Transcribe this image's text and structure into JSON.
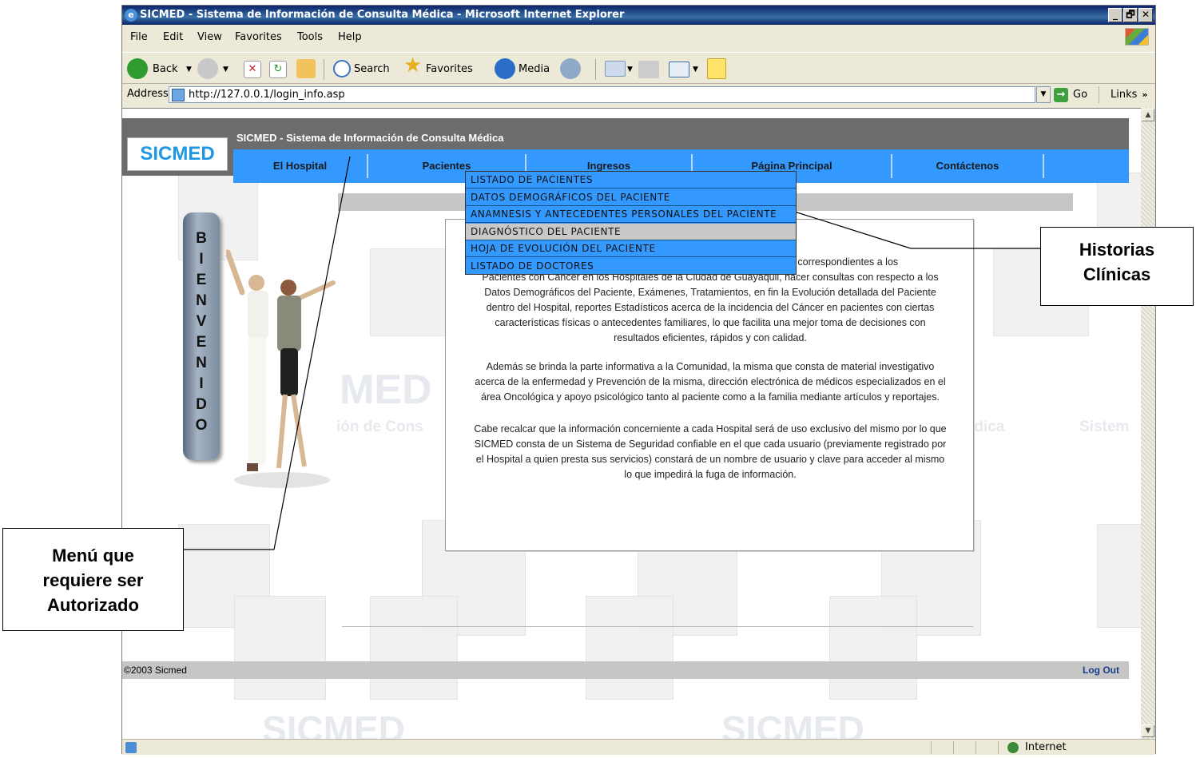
{
  "window": {
    "title": "SICMED - Sistema de Información de Consulta Médica - Microsoft Internet Explorer",
    "controls": [
      "_",
      "🗗",
      "✕"
    ]
  },
  "menubar": [
    "File",
    "Edit",
    "View",
    "Favorites",
    "Tools",
    "Help"
  ],
  "toolbar": {
    "back": "Back",
    "search": "Search",
    "favorites": "Favorites",
    "media": "Media"
  },
  "address": {
    "label": "Address",
    "url": "http://127.0.0.1/login_info.asp",
    "go": "Go",
    "links": "Links"
  },
  "site": {
    "title": "SICMED - Sistema de Información de Consulta Médica",
    "logo": "SICMED",
    "nav": [
      "El Hospital",
      "Pacientes",
      "Ingresos",
      "Página Principal",
      "Contáctenos"
    ],
    "dropdown": [
      "LISTADO DE PACIENTES",
      "DATOS DEMOGRÁFICOS DEL PACIENTE",
      "ANAMNESIS Y ANTECEDENTES PERSONALES DEL PACIENTE",
      "DIAGNÓSTICO DEL PACIENTE",
      "HOJA DE EVOLUCIÓN DEL PACIENTE",
      "LISTADO DE DOCTORES"
    ],
    "welcome_letters": [
      "B",
      "I",
      "E",
      "N",
      "V",
      "E",
      "N",
      "I",
      "D",
      "O"
    ],
    "paragraph1": [
      "Este sistema permite llevar el control de las Historias Clínicas correspondientes a los",
      "Pacientes con Cáncer en los Hospitales de la Ciudad de Guayaquil, hacer consultas con respecto a los",
      "Datos Demográficos del Paciente, Exámenes, Tratamientos, en fin la Evolución detallada del Paciente",
      "dentro del Hospital, reportes Estadísticos acerca de la incidencia del Cáncer en pacientes con ciertas",
      "características físicas o antecedentes familiares, lo que facilita una mejor toma de decisiones con",
      "resultados eficientes, rápidos y con calidad."
    ],
    "paragraph2": [
      "Además se brinda la parte informativa a la Comunidad, la misma que consta de material investigativo",
      "acerca de la enfermedad y Prevención de la misma, dirección electrónica de médicos especializados en el",
      "área Oncológica y apoyo psicológico tanto al paciente como a la familia mediante artículos y reportajes."
    ],
    "paragraph3": [
      "Cabe recalcar que la información concerniente a cada Hospital será de uso exclusivo del mismo por lo que",
      "SICMED consta de un Sistema de Seguridad confiable en el que cada usuario (previamente registrado por",
      "el Hospital a quien presta sus servicios) constará de un nombre de usuario y clave para acceder al mismo",
      "lo que impedirá la fuga de información."
    ],
    "bg_watermark_big": "MED",
    "bg_watermark_mid": [
      "ión de Cons",
      "Médica",
      "Sistem"
    ],
    "bg_watermark_bottom": [
      "SICMED",
      "SICMED"
    ],
    "copyright": "©2003 Sicmed",
    "logout": "Log Out"
  },
  "statusbar": {
    "zone": "Internet"
  },
  "callouts": {
    "historias": [
      "Historias",
      "Clínicas"
    ],
    "menu": [
      "Menú que",
      "requiere ser",
      "Autorizado"
    ]
  },
  "colors": {
    "nav_blue": "#3399ff",
    "logo_blue": "#1f98e4",
    "logout_blue": "#1a3e8c",
    "header_gray": "#6c6c6c"
  }
}
